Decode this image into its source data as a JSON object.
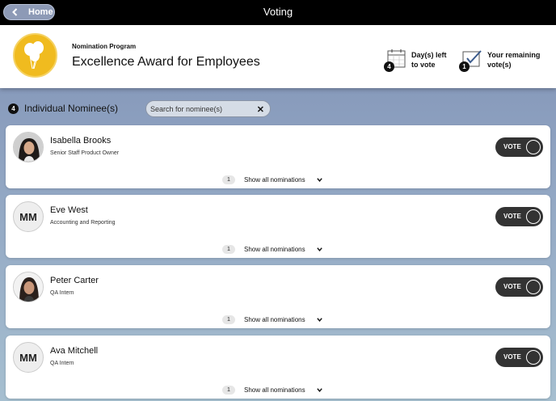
{
  "topbar": {
    "home_label": "Home",
    "title": "Voting"
  },
  "header": {
    "program_label": "Nomination Program",
    "program_title": "Excellence Award for Employees",
    "days_left": {
      "count": "4",
      "label": "Day(s) left\nto vote",
      "icon": "calendar-icon"
    },
    "remaining_votes": {
      "count": "1",
      "label": "Your remaining\nvote(s)",
      "icon": "checkbox-icon"
    }
  },
  "list": {
    "count": "4",
    "title": "Individual Nominee(s)",
    "search_placeholder": "Search for nominee(s)",
    "clear_icon": "close-icon"
  },
  "nominees": [
    {
      "name": "Isabella Brooks",
      "role": "Senior Staff Product Owner",
      "initials": "",
      "photo": true,
      "nominations": "1",
      "show_label": "Show all nominations",
      "vote_label": "VOTE"
    },
    {
      "name": "Eve West",
      "role": "Accounting and Reporting",
      "initials": "MM",
      "photo": false,
      "nominations": "1",
      "show_label": "Show all nominations",
      "vote_label": "VOTE"
    },
    {
      "name": "Peter Carter",
      "role": "QA Intern",
      "initials": "",
      "photo": true,
      "nominations": "1",
      "show_label": "Show all nominations",
      "vote_label": "VOTE"
    },
    {
      "name": "Ava Mitchell",
      "role": "QA Intern",
      "initials": "MM",
      "photo": false,
      "nominations": "1",
      "show_label": "Show all nominations",
      "vote_label": "VOTE"
    }
  ],
  "colors": {
    "topbar": "#000000",
    "logo": "#f0bb1f",
    "vote_button": "#333333"
  }
}
